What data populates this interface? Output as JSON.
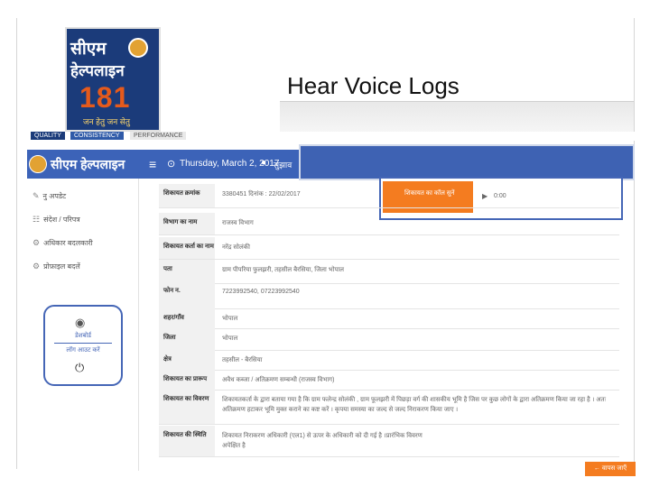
{
  "slide": {
    "title": "Hear Voice Logs"
  },
  "logo": {
    "line1": "सीएम",
    "line2": "हेल्पलाइन",
    "number": "181",
    "tagline": "जन हेतु जन सेतु"
  },
  "qcp": [
    "QUALITY",
    "CONSISTENCY",
    "PERFORMANCE"
  ],
  "header": {
    "brand": "सीएम हेल्पलाइन",
    "date": "Thursday, March 2, 2017",
    "link": "सुझाव",
    "icons": {
      "menu": "≡",
      "calendar": "⊙",
      "chat": "●"
    }
  },
  "sidebar": {
    "items": [
      {
        "icon": "✎",
        "label": "नु अपडेट"
      },
      {
        "icon": "☷",
        "label": "संदेश / परिपत्र"
      },
      {
        "icon": "⚙",
        "label": "अधिकार बदलकारी"
      },
      {
        "icon": "⚙",
        "label": "प्रोफ़ाइल बदलें"
      }
    ],
    "panel": {
      "dashboard": "डेशबोर्ड",
      "login": "लॉग आउट करें"
    }
  },
  "audio": {
    "button": "शिकायत का कॉल सुनें",
    "play": "▶",
    "time": "0:00"
  },
  "rows": [
    {
      "label": "शिकायत क्रमांक",
      "value": "3380451 दिनांक : 22/02/2017"
    },
    {
      "label": "विभाग का नाम",
      "value": "राजस्व विभाग"
    },
    {
      "label": "शिकायत कर्ता का नाम",
      "value": "नरेंद्र सोलंकी"
    },
    {
      "label": "पता",
      "value": "ग्राम पीपरिया फुलझरी, तहसील बैरसिया, जिला भोपाल"
    },
    {
      "label": "फोन न.",
      "value": "7223992540, 07223992540"
    },
    {
      "label": "शहर/गाँव",
      "value": "भोपाल"
    },
    {
      "label": "जिला",
      "value": "भोपाल"
    },
    {
      "label": "क्षेत्र",
      "value": "तहसील - बैरसिया"
    },
    {
      "label": "शिकायत का प्रारूप",
      "value": "अवैध कब्जा / अतिक्रमण सम्बन्धी (राजस्व विभाग)"
    },
    {
      "label": "शिकायत का विवरण",
      "value": "शिकायतकर्ता के द्वारा बताया गया है कि ग्राम फलेन्द्र सोलंकी , ग्राम फूलझरी में पिछड़ा वर्ग की शासकीय भूमि है जिस पर कुछ लोगों के द्वारा अतिक्रमण किया जा रहा है । अतः अतिक्रमण हटाकर भूमि मुक्त कराने का कष्ट करें । कृपया समस्या का जल्द से जल्द निराकरण किया जाए ।"
    },
    {
      "label": "शिकायत की स्थिति",
      "value": "शिकायत निराकरण अधिकारी (एल1) से ऊपर के अधिकारी को दी गई है ।प्रारंभिक विवरण अपेक्षित है"
    }
  ],
  "back_button": "← वापस जाएँ",
  "colors": {
    "brand_blue": "#3c63b8",
    "accent_orange": "#f47c20"
  }
}
